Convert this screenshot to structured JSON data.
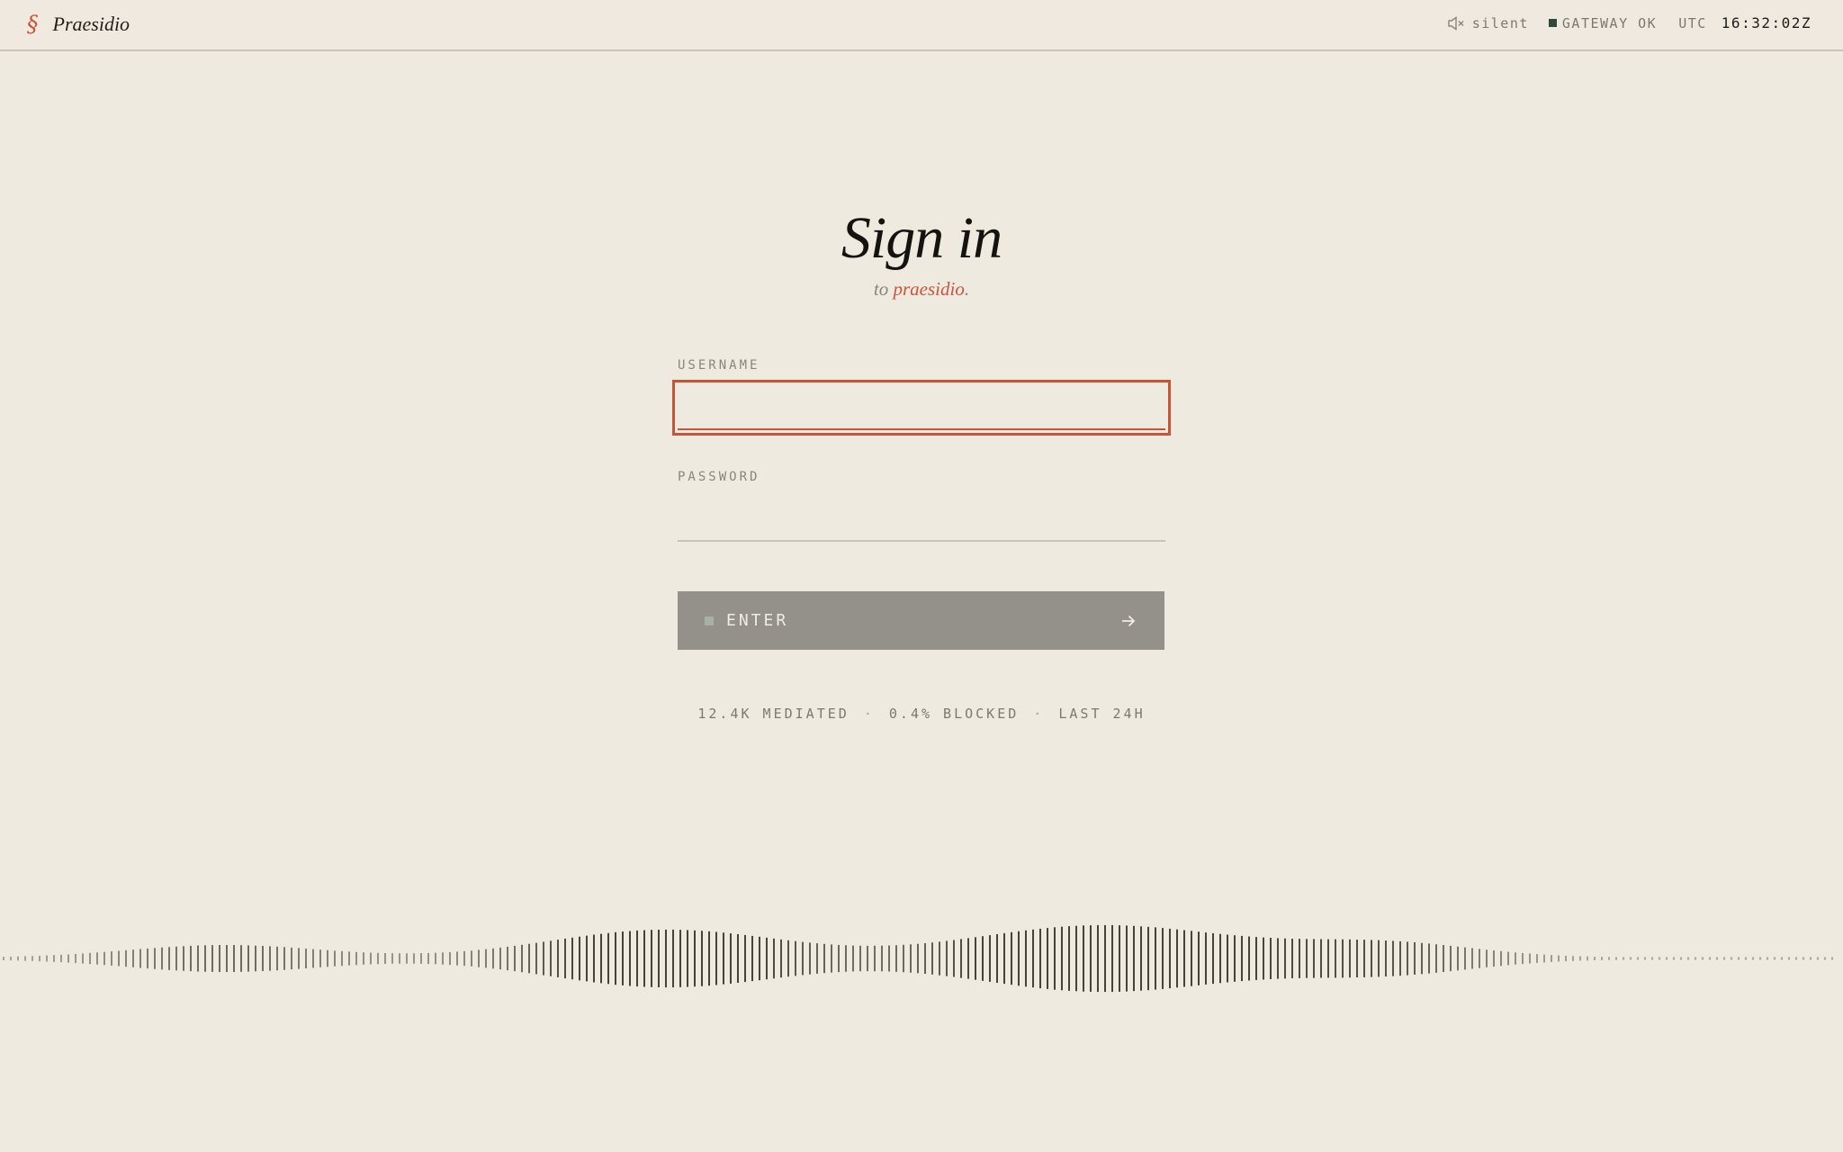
{
  "header": {
    "brand_mark": "§",
    "brand_name": "Praesidio",
    "sound_status": "silent",
    "gateway_status": "GATEWAY OK",
    "timezone": "UTC",
    "clock": "16:32:02Z",
    "gateway_color": "#2f4a3a"
  },
  "signin": {
    "title": "Sign in",
    "subtitle_prefix": "to ",
    "subtitle_brand": "praesidio",
    "subtitle_suffix": "."
  },
  "form": {
    "username_label": "USERNAME",
    "username_value": "",
    "password_label": "PASSWORD",
    "password_value": "",
    "enter_label": "ENTER"
  },
  "stats": {
    "mediated": "12.4K MEDIATED",
    "blocked": "0.4% BLOCKED",
    "window": "LAST 24H"
  },
  "colors": {
    "accent": "#c8543a",
    "background": "#efeae0",
    "button": "#94918a"
  },
  "icons": {
    "brand": "section-sign-icon",
    "sound": "speaker-muted-icon",
    "gateway": "status-square-icon",
    "enter_status": "status-square-icon",
    "enter_arrow": "arrow-right-icon"
  }
}
